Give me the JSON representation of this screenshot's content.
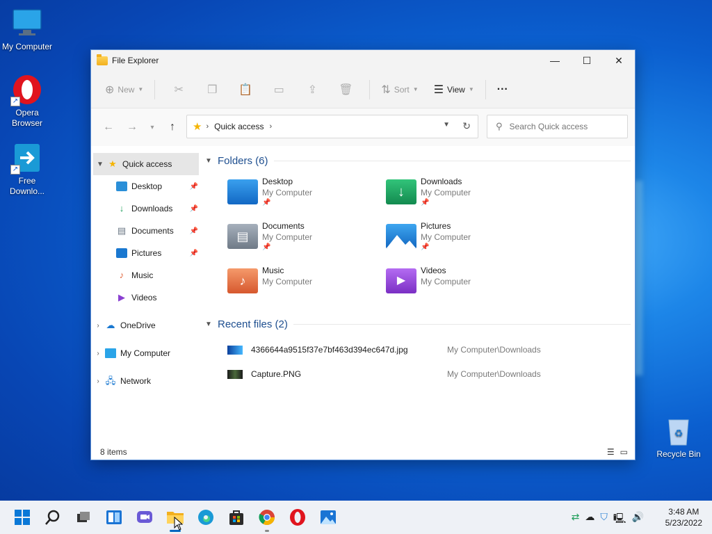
{
  "desktop": {
    "icons": [
      {
        "label": "My Computer"
      },
      {
        "label": "Opera Browser"
      },
      {
        "label": "Free Downlo..."
      }
    ],
    "recycle_bin_label": "Recycle Bin"
  },
  "window": {
    "title": "File Explorer",
    "buttons": {
      "minimize": "—",
      "maximize": "☐",
      "close": "✕"
    }
  },
  "toolbar": {
    "new_label": "New",
    "sort_label": "Sort",
    "view_label": "View",
    "more_label": "···"
  },
  "address": {
    "crumb": "Quick access",
    "search_placeholder": "Search Quick access"
  },
  "sidebar": {
    "quick_access": "Quick access",
    "pinned": [
      {
        "label": "Desktop"
      },
      {
        "label": "Downloads"
      },
      {
        "label": "Documents"
      },
      {
        "label": "Pictures"
      },
      {
        "label": "Music"
      },
      {
        "label": "Videos"
      }
    ],
    "roots": [
      {
        "label": "OneDrive"
      },
      {
        "label": "My Computer"
      },
      {
        "label": "Network"
      }
    ]
  },
  "content": {
    "folders_header": "Folders (6)",
    "folders": [
      {
        "name": "Desktop",
        "location": "My Computer"
      },
      {
        "name": "Downloads",
        "location": "My Computer"
      },
      {
        "name": "Documents",
        "location": "My Computer"
      },
      {
        "name": "Pictures",
        "location": "My Computer"
      },
      {
        "name": "Music",
        "location": "My Computer"
      },
      {
        "name": "Videos",
        "location": "My Computer"
      }
    ],
    "recent_header": "Recent files (2)",
    "recent": [
      {
        "name": "4366644a9515f37e7bf463d394ec647d.jpg",
        "location": "My Computer\\Downloads"
      },
      {
        "name": "Capture.PNG",
        "location": "My Computer\\Downloads"
      }
    ]
  },
  "status": {
    "items": "8 items"
  },
  "taskbar": {
    "time": "3:48 AM",
    "date": "5/23/2022"
  },
  "colors": {
    "accent": "#0067c0",
    "section_header": "#1d4e8f",
    "folder_yellow": "#f2b01e"
  }
}
